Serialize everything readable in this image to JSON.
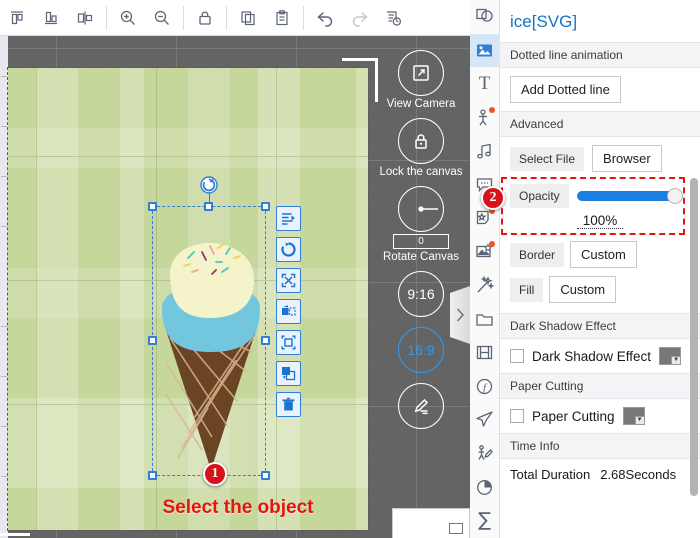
{
  "toolbar": {
    "buttons": [
      {
        "name": "align-top-icon",
        "label": "Align Top"
      },
      {
        "name": "align-bottom-icon",
        "label": "Align Bottom"
      },
      {
        "name": "align-center-icon",
        "label": "Align Center"
      },
      {
        "name": "zoom-in-icon",
        "label": "Zoom In"
      },
      {
        "name": "zoom-out-icon",
        "label": "Zoom Out"
      },
      {
        "name": "lock-icon",
        "label": "Lock"
      },
      {
        "name": "copy-icon",
        "label": "Copy"
      },
      {
        "name": "paste-icon",
        "label": "Paste"
      },
      {
        "name": "undo-icon",
        "label": "Undo"
      },
      {
        "name": "redo-icon",
        "label": "Redo"
      },
      {
        "name": "history-icon",
        "label": "History"
      }
    ]
  },
  "canvas": {
    "controls": {
      "view_camera_label": "View Camera",
      "lock_canvas_label": "Lock the canvas",
      "rotate_canvas_label": "Rotate Canvas",
      "rotate_value": "0",
      "ratio_portrait": "9:16",
      "ratio_landscape": "16:9",
      "active_ratio": "16:9"
    },
    "collapse_icon": "chevron-right-icon"
  },
  "annotations": {
    "step1_number": "1",
    "step1_caption": "Select the object",
    "step2_number": "2"
  },
  "object_tools": [
    {
      "name": "order-layers-icon"
    },
    {
      "name": "rotate-refresh-icon"
    },
    {
      "name": "resize-expand-icon"
    },
    {
      "name": "flip-mirror-icon"
    },
    {
      "name": "fit-crop-icon"
    },
    {
      "name": "duplicate-icon"
    },
    {
      "name": "delete-trash-icon"
    }
  ],
  "iconbar": {
    "items": [
      {
        "name": "sidebar-item-shapes",
        "icon": "shapes-icon",
        "selected": false,
        "dot": false
      },
      {
        "name": "sidebar-item-image",
        "icon": "image-icon",
        "selected": true,
        "dot": false
      },
      {
        "name": "sidebar-item-text",
        "icon": "text-t-icon",
        "selected": false,
        "dot": false
      },
      {
        "name": "sidebar-item-character",
        "icon": "person-icon",
        "selected": false,
        "dot": true
      },
      {
        "name": "sidebar-item-music",
        "icon": "music-note-icon",
        "selected": false,
        "dot": false
      },
      {
        "name": "sidebar-item-bubble",
        "icon": "speech-bubble-icon",
        "selected": false,
        "dot": false
      },
      {
        "name": "sidebar-item-sticker",
        "icon": "sticker-star-icon",
        "selected": false,
        "dot": true
      },
      {
        "name": "sidebar-item-gallery",
        "icon": "image-star-icon",
        "selected": false,
        "dot": true
      },
      {
        "name": "sidebar-item-magic",
        "icon": "magic-wand-icon",
        "selected": false,
        "dot": false
      },
      {
        "name": "sidebar-item-folder",
        "icon": "folder-icon",
        "selected": false,
        "dot": false
      },
      {
        "name": "sidebar-item-video",
        "icon": "film-strip-icon",
        "selected": false,
        "dot": false
      },
      {
        "name": "sidebar-item-function",
        "icon": "function-f-icon",
        "selected": false,
        "dot": false
      },
      {
        "name": "sidebar-item-motion",
        "icon": "airplane-icon",
        "selected": false,
        "dot": false
      },
      {
        "name": "sidebar-item-pose",
        "icon": "person-edit-icon",
        "selected": false,
        "dot": false
      },
      {
        "name": "sidebar-item-chart",
        "icon": "pie-chart-icon",
        "selected": false,
        "dot": false
      },
      {
        "name": "sidebar-item-formula",
        "icon": "sigma-sum-icon",
        "selected": false,
        "dot": false
      }
    ]
  },
  "properties": {
    "title": "ice[SVG]",
    "dotted_line_section": "Dotted line animation",
    "add_dotted_line": "Add Dotted line",
    "advanced_section": "Advanced",
    "select_file": "Select File",
    "browser": "Browser",
    "opacity_label": "Opacity",
    "opacity_value": "100%",
    "opacity_percent": 100,
    "border_label": "Border",
    "border_value": "Custom",
    "fill_label": "Fill",
    "fill_value": "Custom",
    "dark_shadow_section": "Dark Shadow Effect",
    "dark_shadow_label": "Dark Shadow Effect",
    "dark_shadow_checked": false,
    "paper_cutting_section": "Paper Cutting",
    "paper_cutting_label": "Paper Cutting",
    "paper_cutting_checked": false,
    "time_info_section": "Time Info",
    "total_duration_label": "Total Duration",
    "total_duration_value": "2.68Seconds"
  },
  "colors": {
    "accent_blue": "#1473c8",
    "slider_blue": "#1a7fe0",
    "annotation_red": "#e8140c",
    "stage_grey": "#646464",
    "canvas_green": "#c6d79b",
    "selection_blue": "#2f7fd8",
    "ratio_active": "#2b9bf4"
  }
}
